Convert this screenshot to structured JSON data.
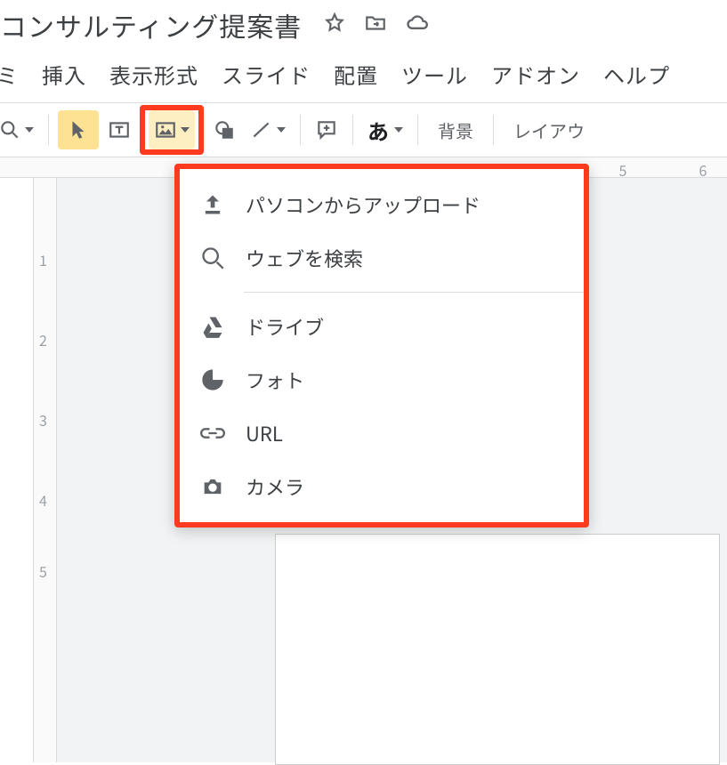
{
  "header": {
    "title": "コンサルティング提案書"
  },
  "menubar": {
    "items": [
      "挿入",
      "表示形式",
      "スライド",
      "配置",
      "ツール",
      "アドオン",
      "ヘルプ"
    ],
    "partial_left": "ミ"
  },
  "toolbar": {
    "text_glyph": "あ",
    "background_label": "背景",
    "layout_label": "レイアウ"
  },
  "ruler": {
    "h": [
      "5",
      "6"
    ],
    "v": [
      "1",
      "2",
      "3",
      "4",
      "5"
    ]
  },
  "dropdown": {
    "items": [
      {
        "icon": "upload-icon",
        "label": "パソコンからアップロード"
      },
      {
        "icon": "search-icon",
        "label": "ウェブを検索"
      }
    ],
    "items2": [
      {
        "icon": "drive-icon",
        "label": "ドライブ"
      },
      {
        "icon": "photos-icon",
        "label": "フォト"
      },
      {
        "icon": "link-icon",
        "label": "URL"
      },
      {
        "icon": "camera-icon",
        "label": "カメラ"
      }
    ]
  }
}
